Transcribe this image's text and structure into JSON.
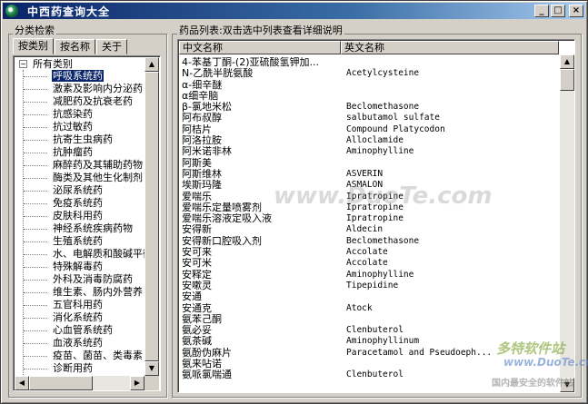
{
  "window": {
    "title": "中西药查询大全"
  },
  "left_panel": {
    "group_title": "分类检索",
    "tabs": [
      {
        "label": "按类别"
      },
      {
        "label": "按名称"
      },
      {
        "label": "关于"
      }
    ],
    "tree_root": {
      "label": "所有类别",
      "expander": "−"
    },
    "tree_items": [
      {
        "label": "呼吸系统药"
      },
      {
        "label": "激素及影响内分泌药"
      },
      {
        "label": "减肥药及抗衰老药"
      },
      {
        "label": "抗感染药"
      },
      {
        "label": "抗过敏药"
      },
      {
        "label": "抗寄生虫病药"
      },
      {
        "label": "抗肿瘤药"
      },
      {
        "label": "麻醉药及其辅助药物"
      },
      {
        "label": "酶类及其他生化制剂"
      },
      {
        "label": "泌尿系统药"
      },
      {
        "label": "免疫系统药"
      },
      {
        "label": "皮肤科用药"
      },
      {
        "label": "神经系统疾病药物"
      },
      {
        "label": "生殖系统药"
      },
      {
        "label": "水、电解质和酸碱平衡"
      },
      {
        "label": "特殊解毒药"
      },
      {
        "label": "外科及消毒防腐药"
      },
      {
        "label": "维生素、肠内外营养"
      },
      {
        "label": "五官科用药"
      },
      {
        "label": "消化系统药"
      },
      {
        "label": "心血管系统药"
      },
      {
        "label": "血液系统药"
      },
      {
        "label": "疫苗、菌苗、类毒素"
      },
      {
        "label": "诊断用药"
      }
    ]
  },
  "right_panel": {
    "group_title": "药品列表:双击选中列表查看详细说明",
    "columns": [
      "中文名称",
      "英文名称"
    ],
    "rows": [
      [
        "4-苯基丁酮-(2)亚硫酸氢钾加...",
        ""
      ],
      [
        "N-乙酰半胱氨酸",
        "Acetylcysteine"
      ],
      [
        "α-细辛醚",
        ""
      ],
      [
        "α细辛脑",
        ""
      ],
      [
        "β-氯地米松",
        "Beclomethasone"
      ],
      [
        "阿布叔醇",
        "salbutamol sulfate"
      ],
      [
        "阿桔片",
        "Compound Platycodon"
      ],
      [
        "阿洛拉胺",
        "Alloclamide"
      ],
      [
        "阿米诺非林",
        "Aminophylline"
      ],
      [
        "阿斯美",
        ""
      ],
      [
        "阿斯维林",
        "ASVERIN"
      ],
      [
        "埃斯玛隆",
        "ASMALON"
      ],
      [
        "爱喘乐",
        "Ipratropine"
      ],
      [
        "爱喘乐定量喷雾剂",
        "Ipratropine"
      ],
      [
        "爱喘乐溶液定吸入液",
        "Ipratropine"
      ],
      [
        "安得新",
        "Aldecin"
      ],
      [
        "安得新口腔吸入剂",
        "Beclomethasone"
      ],
      [
        "安可来",
        "Accolate"
      ],
      [
        "安可米",
        "Accolate"
      ],
      [
        "安释定",
        "Aminophylline"
      ],
      [
        "安嗽灵",
        "Tipepidine"
      ],
      [
        "安通",
        ""
      ],
      [
        "安通克",
        "Atock"
      ],
      [
        "氨苯己酮",
        ""
      ],
      [
        "氨必妥",
        "Clenbuterol"
      ],
      [
        "氨茶碱",
        "Aminophyllinum"
      ],
      [
        "氨酚伪麻片",
        "Paracetamol and Pseudoeph..."
      ],
      [
        "氨来呫诺",
        ""
      ],
      [
        "氨哌氯喘通",
        "Clenbuterol"
      ]
    ]
  },
  "watermarks": {
    "center": "www.DuoTe.com",
    "corner_brand": "多特软件站",
    "corner_url": "www.DuoTe.com",
    "corner_slogan": "国内最安全的软件站"
  }
}
